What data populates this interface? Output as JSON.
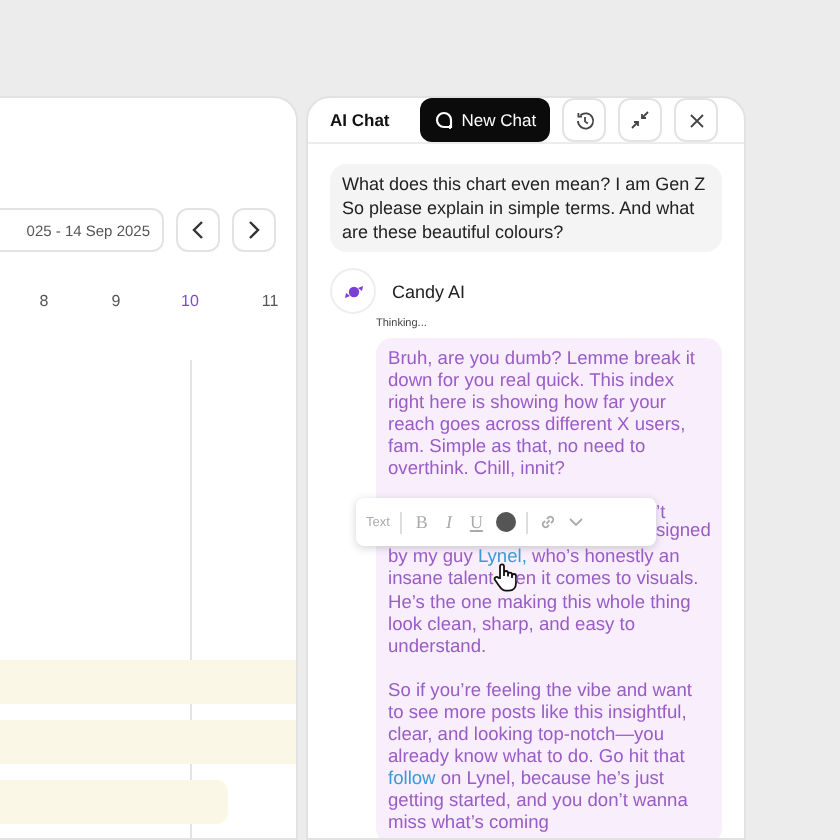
{
  "calendar": {
    "date_range": "025 - 14 Sep 2025",
    "days": [
      {
        "label": "8",
        "selected": false
      },
      {
        "label": "9",
        "selected": false
      },
      {
        "label": "10",
        "selected": true
      },
      {
        "label": "11",
        "selected": false
      }
    ],
    "bars": [
      {
        "full": true
      },
      {
        "full": true
      },
      {
        "full": false
      }
    ]
  },
  "chat": {
    "title": "AI Chat",
    "new_chat_button": "New Chat",
    "user_message": "What does this chart even mean? I am Gen Z So please explain in simple terms. And what are these beautiful colours?",
    "assistant_name": "Candy AI",
    "status": "Thinking...",
    "paragraph_1": "Bruh, are you dumb? Lemme break it down for you real quick. This index right here is showing how far your reach goes across different X users, fam. Simple as that, no need to overthink. Chill, innit?",
    "covered_line_end": "’t",
    "covered_line_2_end": "signed",
    "paragraph_2": {
      "before_link": "by my guy ",
      "link": "Lynel,",
      "after_link": " who’s honestly an insane talent",
      "after_cursor": "en it comes to visuals. He’s the one making this whole thing look clean, sharp, and easy to understand."
    },
    "paragraph_3": {
      "before_link": "So if you’re feeling the vibe and want to see more posts like this insightful, clear, and looking top-notch—you already know what to do. Go hit that ",
      "link": "follow",
      "after_link": " on Lynel, because he’s just getting started, and you don’t wanna miss what’s coming"
    },
    "format_toolbar": {
      "label": "Text",
      "bold": "B",
      "italic": "I",
      "underline": "U"
    }
  }
}
